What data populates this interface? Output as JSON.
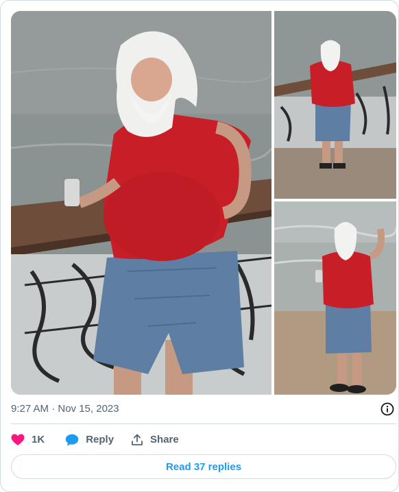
{
  "tweet": {
    "timestamp": "9:27 AM · Nov 15, 2023",
    "media": [
      {
        "name": "photo-1"
      },
      {
        "name": "photo-2"
      },
      {
        "name": "photo-3"
      }
    ]
  },
  "actions": {
    "like": {
      "icon": "heart-icon",
      "count": "1K",
      "color": "#f91880"
    },
    "reply": {
      "icon": "speech-bubble-icon",
      "label": "Reply",
      "color": "#1d9bf0"
    },
    "share": {
      "icon": "share-upload-icon",
      "label": "Share"
    }
  },
  "info": {
    "icon": "info-icon"
  },
  "read_replies": {
    "label": "Read 37 replies",
    "color": "#1d9bf0"
  },
  "colors": {
    "text_secondary": "#536471",
    "border": "#cfd9de",
    "accent": "#1d9bf0"
  }
}
